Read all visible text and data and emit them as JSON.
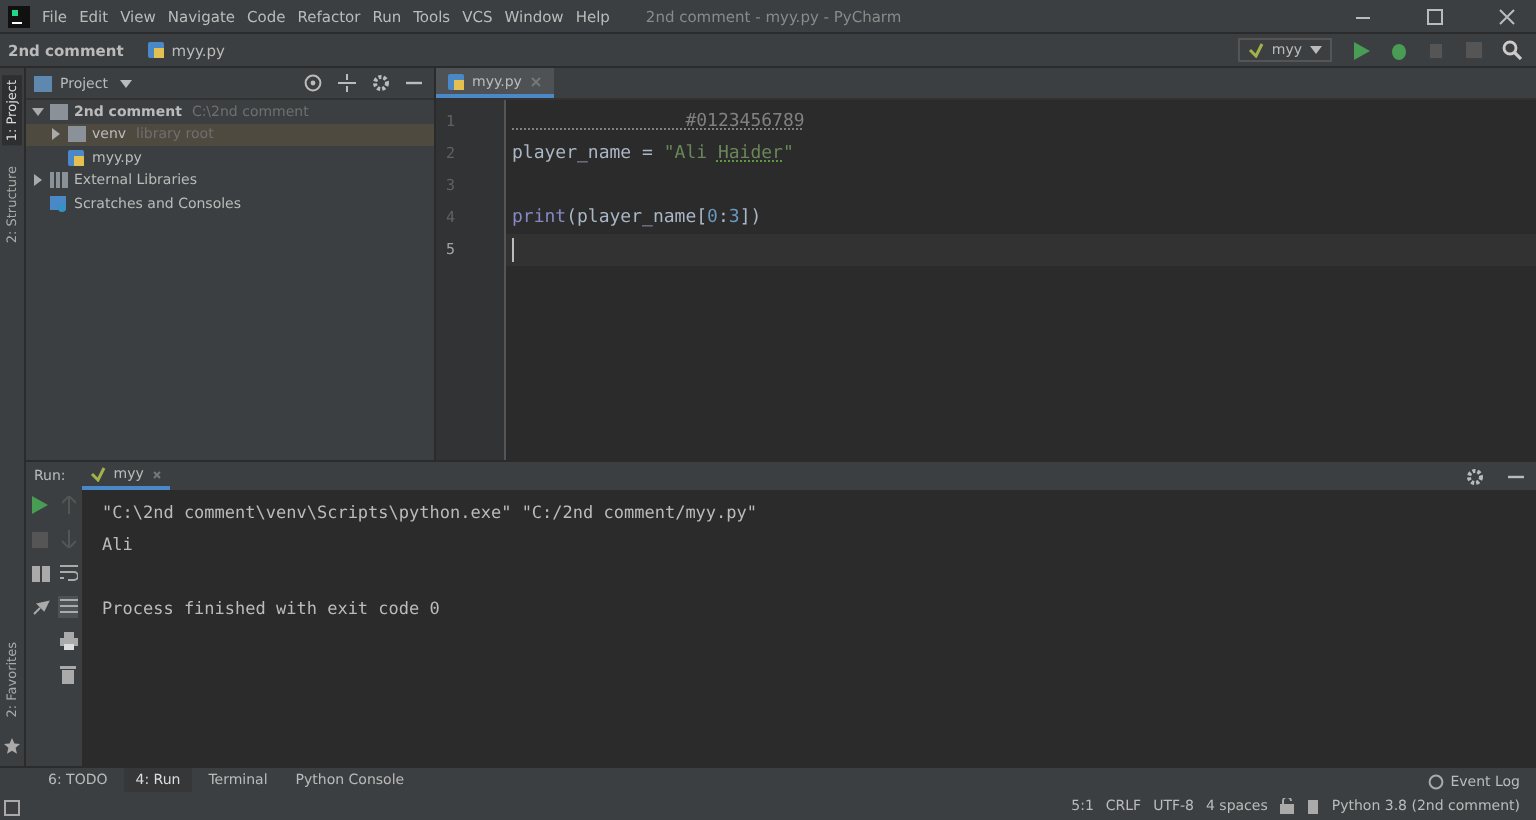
{
  "window": {
    "title": "2nd comment - myy.py - PyCharm",
    "menu": [
      "File",
      "Edit",
      "View",
      "Navigate",
      "Code",
      "Refactor",
      "Run",
      "Tools",
      "VCS",
      "Window",
      "Help"
    ]
  },
  "breadcrumb": [
    "2nd comment",
    "myy.py"
  ],
  "run_config": {
    "label": "myy"
  },
  "left_stripe": {
    "top": [
      {
        "label": "1: Project",
        "selected": true
      },
      {
        "label": "2: Structure",
        "selected": false
      }
    ],
    "bottom": [
      {
        "label": "2: Favorites",
        "selected": false
      }
    ]
  },
  "project": {
    "title": "Project",
    "tree": [
      {
        "label": "2nd comment",
        "hint": "C:\\2nd comment",
        "kind": "folder",
        "expanded": true,
        "selected": false,
        "children": [
          {
            "label": "venv",
            "hint": "library root",
            "kind": "folder",
            "expanded": false,
            "selected": true
          },
          {
            "label": "myy.py",
            "kind": "file",
            "selected": false
          }
        ]
      },
      {
        "label": "External Libraries",
        "kind": "library",
        "expanded": false,
        "selected": false
      },
      {
        "label": "Scratches and Consoles",
        "kind": "scratch",
        "selected": false
      }
    ]
  },
  "editor": {
    "tab": "myy.py",
    "lines": [
      {
        "number": "1",
        "current": false,
        "tokens": [
          {
            "text": "                #0123456789",
            "kind": "comment"
          }
        ]
      },
      {
        "number": "2",
        "current": false,
        "tokens": [
          {
            "text": "player_name = ",
            "kind": "plain"
          },
          {
            "text": "\"Ali ",
            "kind": "string"
          },
          {
            "text": "Haider",
            "kind": "string-typo"
          },
          {
            "text": "\"",
            "kind": "string"
          }
        ]
      },
      {
        "number": "3",
        "current": false
      },
      {
        "number": "4",
        "current": false,
        "tokens": [
          {
            "text": "print",
            "kind": "builtin"
          },
          {
            "text": "(player_name[",
            "kind": "plain"
          },
          {
            "text": "0",
            "kind": "number"
          },
          {
            "text": ":",
            "kind": "plain"
          },
          {
            "text": "3",
            "kind": "number"
          },
          {
            "text": "])",
            "kind": "plain"
          }
        ]
      },
      {
        "number": "5",
        "current": true
      }
    ]
  },
  "run": {
    "label": "Run:",
    "tab": "myy",
    "console": [
      {
        "text": "\"C:\\2nd comment\\venv\\Scripts\\python.exe\" \"C:/2nd comment/myy.py\"",
        "kind": "command"
      },
      {
        "text": "Ali",
        "kind": "output"
      },
      {
        "text": "Process finished with exit code 0",
        "kind": "status"
      }
    ]
  },
  "bottom_tabs": [
    {
      "label": "6: TODO",
      "selected": false
    },
    {
      "label": "4: Run",
      "selected": true
    },
    {
      "label": "Terminal",
      "selected": false
    },
    {
      "label": "Python Console",
      "selected": false
    }
  ],
  "event_log": "Event Log",
  "status_bar": [
    "5:1",
    "CRLF",
    "UTF-8",
    "4 spaces",
    "Python 3.8 (2nd comment)"
  ]
}
